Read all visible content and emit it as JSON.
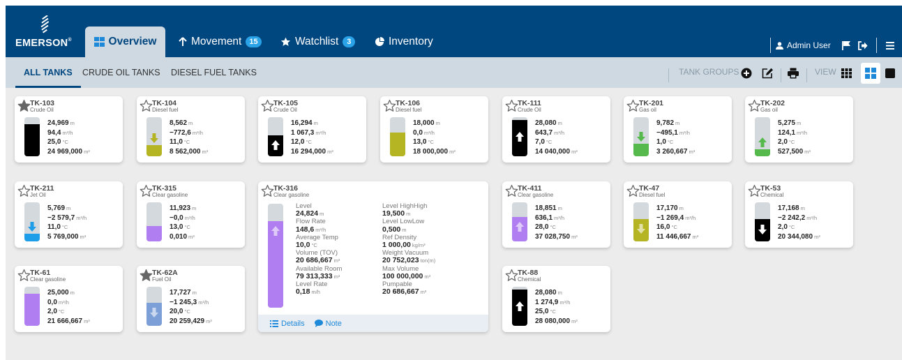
{
  "header": {
    "logo": "EMERSON",
    "tabs": [
      {
        "label": "Overview",
        "icon": "grid-icon",
        "active": true
      },
      {
        "label": "Movement",
        "icon": "arrow-up-icon",
        "badge": "15"
      },
      {
        "label": "Watchlist",
        "icon": "star-icon",
        "badge": "3"
      },
      {
        "label": "Inventory",
        "icon": "pie-chart-icon"
      }
    ],
    "user": "Admin User",
    "icons": [
      "user-icon",
      "flag-icon",
      "sign-out-icon",
      "hamburger-menu-icon"
    ]
  },
  "subnav": {
    "tabs": [
      "ALL TANKS",
      "CRUDE OIL TANKS",
      "DIESEL FUEL TANKS"
    ],
    "active_tab": "ALL TANKS",
    "tank_groups_label": "TANK GROUPS",
    "view_label": "VIEW",
    "icons": [
      "add-circle-icon",
      "edit-icon",
      "print-icon",
      "grid-view-icon",
      "tile-view-icon",
      "square-view-icon"
    ]
  },
  "colors": {
    "header": "#00467f",
    "subnav": "#cfd9e2",
    "black": "#000000",
    "olive": "#b5b524",
    "green": "#55b94b",
    "blue": "#1e9ee8",
    "purple": "#b07ef0",
    "steel": "#7b9fd6"
  },
  "tanks": [
    {
      "name": "TK-103",
      "type": "Crude Oil",
      "starred": true,
      "level": "24,969",
      "level_unit": "m",
      "rate": "94,4",
      "rate_unit": "m³/h",
      "temp": "25,0",
      "temp_unit": "°C",
      "volume": "24 969,000",
      "volume_unit": "m³",
      "fill_color": "black",
      "fill_fraction": 0.83,
      "arrow": "none"
    },
    {
      "name": "TK-104",
      "type": "Diesel fuel",
      "starred": false,
      "level": "8,562",
      "level_unit": "m",
      "rate": "−772,6",
      "rate_unit": "m³/h",
      "temp": "11,0",
      "temp_unit": "°C",
      "volume": "8 562,000",
      "volume_unit": "m³",
      "fill_color": "olive",
      "fill_fraction": 0.29,
      "arrow": "down"
    },
    {
      "name": "TK-105",
      "type": "Crude Oil",
      "starred": false,
      "level": "16,294",
      "level_unit": "m",
      "rate": "1 067,3",
      "rate_unit": "m³/h",
      "temp": "12,0",
      "temp_unit": "°C",
      "volume": "16 294,000",
      "volume_unit": "m³",
      "fill_color": "black",
      "fill_fraction": 0.54,
      "arrow": "up"
    },
    {
      "name": "TK-106",
      "type": "Diesel fuel",
      "starred": false,
      "level": "18,000",
      "level_unit": "m",
      "rate": "0,0",
      "rate_unit": "m³/h",
      "temp": "13,0",
      "temp_unit": "°C",
      "volume": "18 000,000",
      "volume_unit": "m³",
      "fill_color": "olive",
      "fill_fraction": 0.6,
      "arrow": "none"
    },
    {
      "name": "TK-111",
      "type": "Crude Oil",
      "starred": false,
      "level": "28,080",
      "level_unit": "m",
      "rate": "643,7",
      "rate_unit": "m³/h",
      "temp": "7,0",
      "temp_unit": "°C",
      "volume": "14 040,000",
      "volume_unit": "m³",
      "fill_color": "black",
      "fill_fraction": 0.93,
      "arrow": "up"
    },
    {
      "name": "TK-201",
      "type": "Gas oil",
      "starred": false,
      "level": "9,782",
      "level_unit": "m",
      "rate": "−495,1",
      "rate_unit": "m³/h",
      "temp": "1,0",
      "temp_unit": "°C",
      "volume": "3 260,667",
      "volume_unit": "m³",
      "fill_color": "green",
      "fill_fraction": 0.33,
      "arrow": "down"
    },
    {
      "name": "TK-202",
      "type": "Gas oil",
      "starred": false,
      "level": "5,275",
      "level_unit": "m",
      "rate": "124,1",
      "rate_unit": "m³/h",
      "temp": "2,0",
      "temp_unit": "°C",
      "volume": "527,500",
      "volume_unit": "m³",
      "fill_color": "green",
      "fill_fraction": 0.18,
      "arrow": "up"
    },
    {
      "name": "TK-211",
      "type": "Jet Oil",
      "starred": false,
      "level": "5,769",
      "level_unit": "m",
      "rate": "−2 579,7",
      "rate_unit": "m³/h",
      "temp": "11,0",
      "temp_unit": "°C",
      "volume": "5 769,000",
      "volume_unit": "m³",
      "fill_color": "blue",
      "fill_fraction": 0.19,
      "arrow": "down"
    },
    {
      "name": "TK-315",
      "type": "Clear gasoline",
      "starred": false,
      "level": "11,923",
      "level_unit": "m",
      "rate": "−0,0",
      "rate_unit": "m³/h",
      "temp": "13,0",
      "temp_unit": "°C",
      "volume": "0,010",
      "volume_unit": "m³",
      "fill_color": "purple",
      "fill_fraction": 0.4,
      "arrow": "none"
    },
    {
      "name": "TK-411",
      "type": "Clear gasoline",
      "starred": false,
      "level": "18,851",
      "level_unit": "m",
      "rate": "636,1",
      "rate_unit": "m³/h",
      "temp": "28,0",
      "temp_unit": "°C",
      "volume": "37 028,750",
      "volume_unit": "m³",
      "fill_color": "purple",
      "fill_fraction": 0.63,
      "arrow": "up"
    },
    {
      "name": "TK-47",
      "type": "Diesel fuel",
      "starred": false,
      "level": "17,170",
      "level_unit": "m",
      "rate": "−1 269,4",
      "rate_unit": "m³/h",
      "temp": "16,0",
      "temp_unit": "°C",
      "volume": "11 446,667",
      "volume_unit": "m³",
      "fill_color": "olive",
      "fill_fraction": 0.57,
      "arrow": "down"
    },
    {
      "name": "TK-53",
      "type": "Chemical",
      "starred": false,
      "level": "17,168",
      "level_unit": "m",
      "rate": "−2 242,2",
      "rate_unit": "m³/h",
      "temp": "2,0",
      "temp_unit": "°C",
      "volume": "20 344,080",
      "volume_unit": "m³",
      "fill_color": "black",
      "fill_fraction": 0.57,
      "arrow": "down"
    },
    {
      "name": "TK-61",
      "type": "Clear gasoline",
      "starred": false,
      "level": "25,000",
      "level_unit": "m",
      "rate": "0,0",
      "rate_unit": "m³/h",
      "temp": "2,0",
      "temp_unit": "°C",
      "volume": "21 666,667",
      "volume_unit": "m³",
      "fill_color": "purple",
      "fill_fraction": 0.83,
      "arrow": "none"
    },
    {
      "name": "TK-62A",
      "type": "Fuel Oil",
      "starred": true,
      "level": "17,727",
      "level_unit": "m",
      "rate": "−1 245,3",
      "rate_unit": "m³/h",
      "temp": "20,0",
      "temp_unit": "°C",
      "volume": "20 259,429",
      "volume_unit": "m³",
      "fill_color": "steel",
      "fill_fraction": 0.59,
      "arrow": "down"
    },
    {
      "name": "TK-88",
      "type": "Chemical",
      "starred": false,
      "level": "28,080",
      "level_unit": "m",
      "rate": "1 274,9",
      "rate_unit": "m³/h",
      "temp": "25,0",
      "temp_unit": "°C",
      "volume": "28 080,000",
      "volume_unit": "m³",
      "fill_color": "black",
      "fill_fraction": 0.93,
      "arrow": "up"
    }
  ],
  "expanded": {
    "name": "TK-316",
    "type": "Clear gasoline",
    "starred": false,
    "fill_color": "purple",
    "fill_fraction": 0.83,
    "arrow": "up",
    "left": [
      {
        "label": "Level",
        "value": "24,824",
        "unit": "m"
      },
      {
        "label": "Flow Rate",
        "value": "148,6",
        "unit": "m³/h"
      },
      {
        "label": "Average Temp",
        "value": "10,0",
        "unit": "°C"
      },
      {
        "label": "Volume (TOV)",
        "value": "20 686,667",
        "unit": "m³"
      },
      {
        "label": "Available Room",
        "value": "79 313,333",
        "unit": "m³"
      },
      {
        "label": "Level Rate",
        "value": "0,18",
        "unit": "m/h"
      }
    ],
    "right": [
      {
        "label": "Level HighHigh",
        "value": "19,500",
        "unit": "m"
      },
      {
        "label": "Level LowLow",
        "value": "0,500",
        "unit": "m"
      },
      {
        "label": "Ref Density",
        "value": "1 000,00",
        "unit": "kg/m³"
      },
      {
        "label": "Weight Vacuum",
        "value": "20 752,023",
        "unit": "ton(m)"
      },
      {
        "label": "Max Volume",
        "value": "100 000,000",
        "unit": "m³"
      },
      {
        "label": "Pumpable",
        "value": "20 686,667",
        "unit": "m³"
      }
    ],
    "details_label": "Details",
    "note_label": "Note"
  }
}
